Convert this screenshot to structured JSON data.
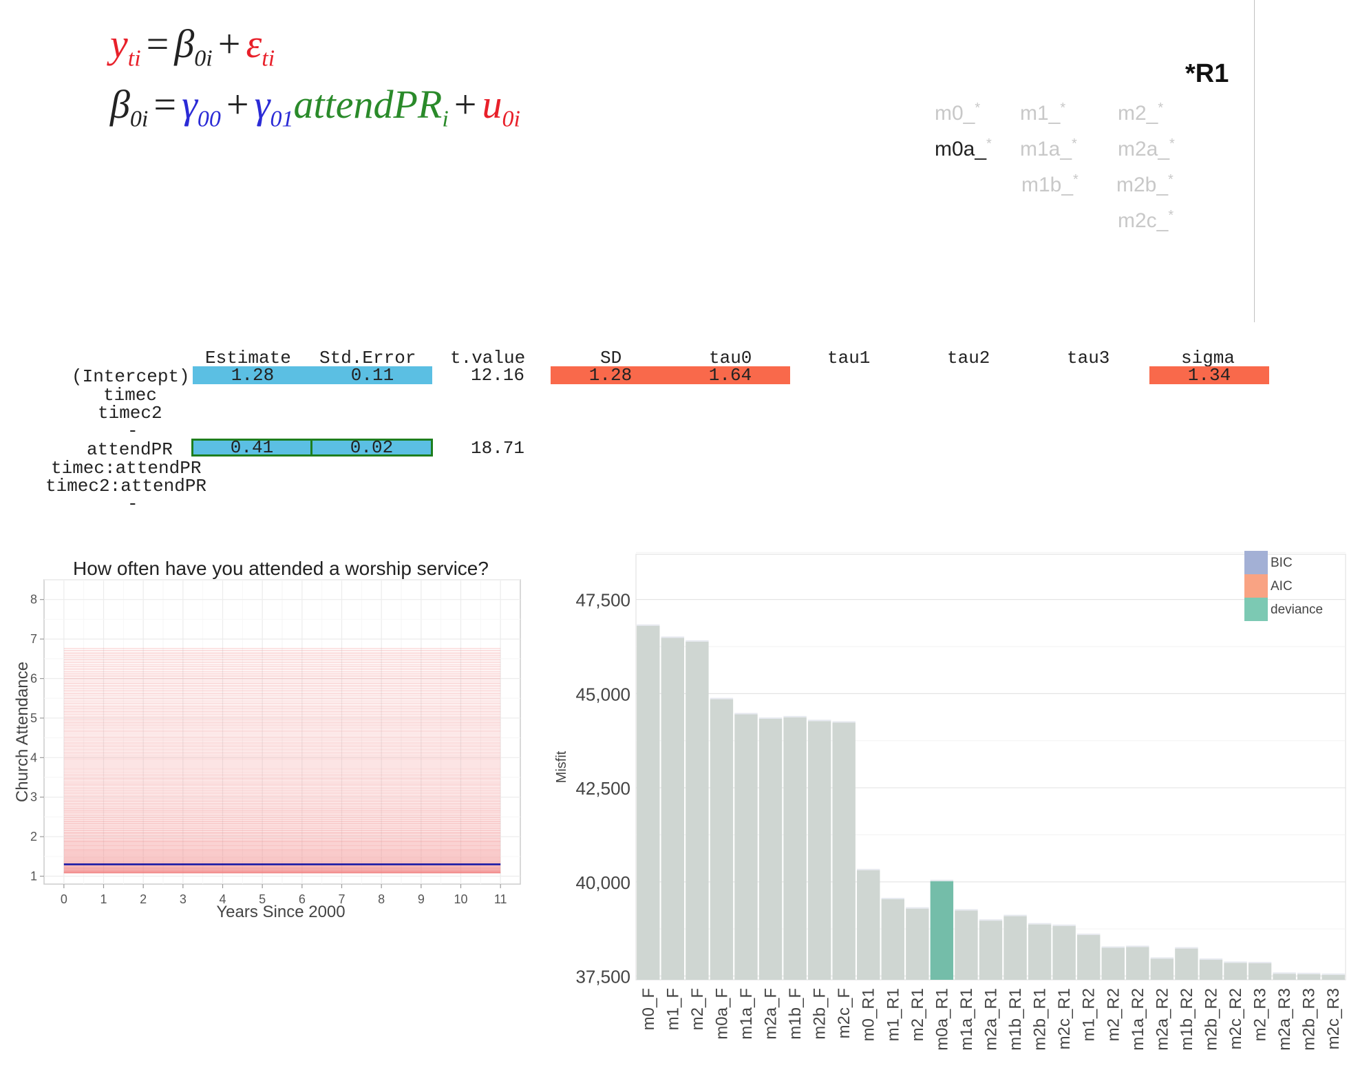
{
  "equations": {
    "level1": {
      "lhs": "y",
      "lhs_sub": "ti",
      "beta": "β",
      "beta_sub": "0i",
      "eps": "ε",
      "eps_sub": "ti"
    },
    "level2": {
      "lhs": "β",
      "lhs_sub": "0i",
      "g00": "γ",
      "g00_sub": "00",
      "g01": "γ",
      "g01_sub": "01",
      "var": "attendPR",
      "var_sub": "i",
      "u": "u",
      "u_sub": "0i"
    }
  },
  "model_label": "*R1",
  "models": [
    {
      "name": "m0_",
      "star": "*",
      "active": false
    },
    {
      "name": "m1_",
      "star": "*",
      "active": false
    },
    {
      "name": "m2_",
      "star": "*",
      "active": false
    },
    {
      "name": "m0a_",
      "star": "*",
      "active": true
    },
    {
      "name": "m1a_",
      "star": "*",
      "active": false
    },
    {
      "name": "m2a_",
      "star": "*",
      "active": false
    },
    {
      "name": "m1b_",
      "star": "*",
      "active": false
    },
    {
      "name": "m2b_",
      "star": "*",
      "active": false
    },
    {
      "name": "m2c_",
      "star": "*",
      "active": false
    }
  ],
  "table": {
    "headers": [
      "Estimate",
      "Std.Error",
      "t.value",
      "SD",
      "tau0",
      "tau1",
      "tau2",
      "tau3",
      "sigma"
    ],
    "row_labels": [
      "(Intercept)",
      "timec",
      "timec2",
      "-",
      "attendPR",
      "timec:attendPR",
      "timec2:attendPR",
      "-"
    ],
    "intercept": {
      "estimate": "1.28",
      "se": "0.11",
      "t": "12.16",
      "sd": "1.28",
      "tau0": "1.64",
      "sigma": "1.34"
    },
    "attendPR": {
      "estimate": "0.41",
      "se": "0.02",
      "t": "18.71"
    }
  },
  "chart_data": [
    {
      "type": "line",
      "title": "How often have you attended a worship service?",
      "xlabel": "Years Since 2000",
      "ylabel": "Church Attendance",
      "xlim": [
        -0.5,
        11.5
      ],
      "ylim": [
        0.8,
        8.5
      ],
      "x_ticks": [
        0,
        1,
        2,
        3,
        4,
        5,
        6,
        7,
        8,
        9,
        10,
        11
      ],
      "y_ticks": [
        1,
        2,
        3,
        4,
        5,
        6,
        7,
        8
      ],
      "grid": true,
      "series": [
        {
          "name": "",
          "color": "#1a1aa6",
          "x": [
            0,
            11
          ],
          "y": [
            1.3,
            1.3
          ]
        }
      ],
      "individual_lines": {
        "color": "#f08080",
        "x": [
          0,
          11
        ],
        "y_min": 1.08,
        "y_max": 6.76,
        "count": 200
      }
    },
    {
      "type": "bar",
      "xlabel": "",
      "ylabel": "Misfit",
      "ylim": [
        37400,
        48700
      ],
      "y_ticks": [
        37500,
        40000,
        42500,
        45000,
        47500
      ],
      "grid": true,
      "legend": {
        "position": "top-right",
        "entries": [
          {
            "name": "BIC",
            "color": "#a3b0d5"
          },
          {
            "name": "AIC",
            "color": "#f9a383"
          },
          {
            "name": "deviance",
            "color": "#7cc9b3"
          }
        ]
      },
      "bar_color": "#cfd6d2",
      "highlight_color": "#74bda9",
      "highlight": "m0a_R1",
      "categories": [
        "m0_F",
        "m1_F",
        "m2_F",
        "m0a_F",
        "m1a_F",
        "m2a_F",
        "m1b_F",
        "m2b_F",
        "m2c_F",
        "m0_R1",
        "m1_R1",
        "m2_R1",
        "m0a_R1",
        "m1a_R1",
        "m2a_R1",
        "m1b_R1",
        "m2b_R1",
        "m2c_R1",
        "m1_R2",
        "m2_R2",
        "m1a_R2",
        "m2a_R2",
        "m1b_R2",
        "m2b_R2",
        "m2c_R2",
        "m2_R3",
        "m2a_R3",
        "m2b_R3",
        "m2c_R3"
      ],
      "values": [
        46800,
        46480,
        46380,
        44850,
        44450,
        44330,
        44370,
        44270,
        44230,
        40310,
        39540,
        39290,
        40020,
        39240,
        38970,
        39090,
        38870,
        38830,
        38590,
        38250,
        38270,
        37960,
        38230,
        37930,
        37850,
        37840,
        37560,
        37550,
        37530
      ]
    }
  ]
}
